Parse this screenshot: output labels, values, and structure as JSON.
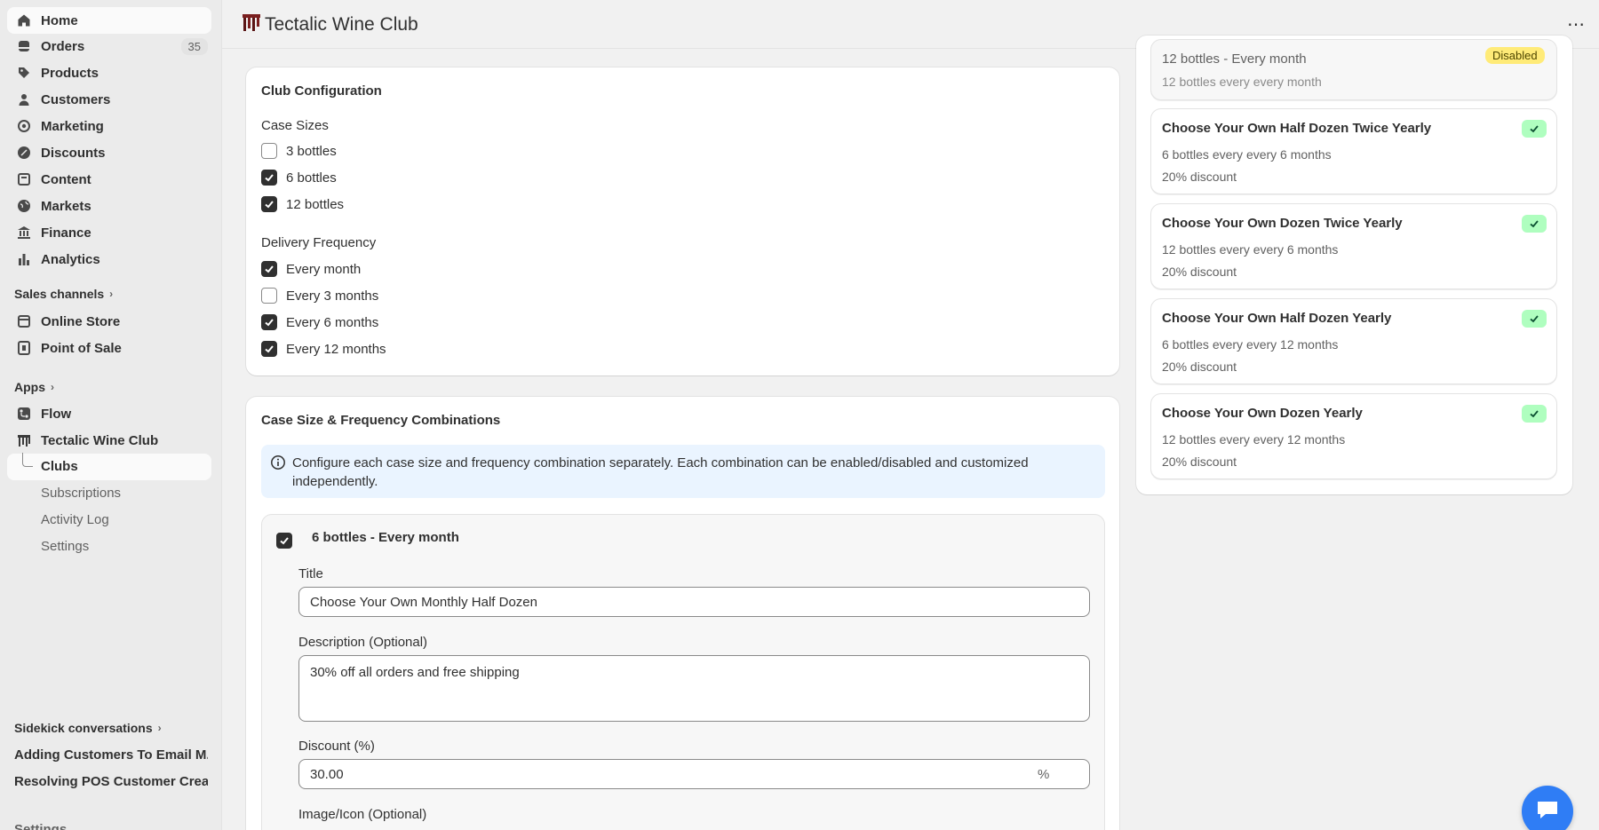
{
  "sidebar": {
    "nav": [
      {
        "label": "Home",
        "icon": "home-icon"
      },
      {
        "label": "Orders",
        "icon": "orders-icon",
        "badge": "35"
      },
      {
        "label": "Products",
        "icon": "tag-icon"
      },
      {
        "label": "Customers",
        "icon": "person-icon"
      },
      {
        "label": "Marketing",
        "icon": "target-icon"
      },
      {
        "label": "Discounts",
        "icon": "discount-icon"
      },
      {
        "label": "Content",
        "icon": "content-icon"
      },
      {
        "label": "Markets",
        "icon": "globe-icon"
      },
      {
        "label": "Finance",
        "icon": "bank-icon"
      },
      {
        "label": "Analytics",
        "icon": "chart-icon"
      }
    ],
    "sales_channels_title": "Sales channels",
    "sales_channels": [
      {
        "label": "Online Store",
        "icon": "store-icon"
      },
      {
        "label": "Point of Sale",
        "icon": "pos-icon"
      }
    ],
    "apps_title": "Apps",
    "apps": [
      {
        "label": "Flow",
        "icon": "flow-icon"
      },
      {
        "label": "Tectalic Wine Club",
        "icon": "wine-club-icon"
      }
    ],
    "app_sub": [
      "Clubs",
      "Subscriptions",
      "Activity Log",
      "Settings"
    ],
    "sidekick_title": "Sidekick conversations",
    "conversations": [
      "Adding Customers To Email M...",
      "Resolving POS Customer Crea..."
    ],
    "settings_label": "Settings"
  },
  "topbar": {
    "title": "Tectalic Wine Club",
    "more": "⋯"
  },
  "club_config": {
    "title": "Club Configuration",
    "case_sizes_label": "Case Sizes",
    "case_sizes": [
      {
        "label": "3 bottles",
        "checked": false
      },
      {
        "label": "6 bottles",
        "checked": true
      },
      {
        "label": "12 bottles",
        "checked": true
      }
    ],
    "frequency_label": "Delivery Frequency",
    "frequencies": [
      {
        "label": "Every month",
        "checked": true
      },
      {
        "label": "Every 3 months",
        "checked": false
      },
      {
        "label": "Every 6 months",
        "checked": true
      },
      {
        "label": "Every 12 months",
        "checked": true
      }
    ]
  },
  "combos": {
    "title": "Case Size & Frequency Combinations",
    "banner": "Configure each case size and frequency combination separately. Each combination can be enabled/disabled and customized independently.",
    "item": {
      "heading": "6 bottles - Every month",
      "checked": true,
      "title_label": "Title",
      "title_value": "Choose Your Own Monthly Half Dozen",
      "description_label": "Description (Optional)",
      "description_value": "30% off all orders and free shipping",
      "discount_label": "Discount (%)",
      "discount_value": "30.00",
      "discount_suffix": "%",
      "image_label": "Image/Icon (Optional)"
    }
  },
  "summary": [
    {
      "title": "12 bottles - Every month",
      "line1": "12 bottles every every month",
      "status": "Disabled"
    },
    {
      "title": "Choose Your Own Half Dozen Twice Yearly",
      "line1": "6 bottles every every 6 months",
      "line2": "20% discount"
    },
    {
      "title": "Choose Your Own Dozen Twice Yearly",
      "line1": "12 bottles every every 6 months",
      "line2": "20% discount"
    },
    {
      "title": "Choose Your Own Half Dozen Yearly",
      "line1": "6 bottles every every 12 months",
      "line2": "20% discount"
    },
    {
      "title": "Choose Your Own Dozen Yearly",
      "line1": "12 bottles every every 12 months",
      "line2": "20% discount"
    }
  ],
  "colors": {
    "accent": "#303030",
    "success_bg": "#affebf",
    "warning_bg": "#ffeb78",
    "info_bg": "#eaf4ff",
    "chat": "#2f7df5"
  }
}
